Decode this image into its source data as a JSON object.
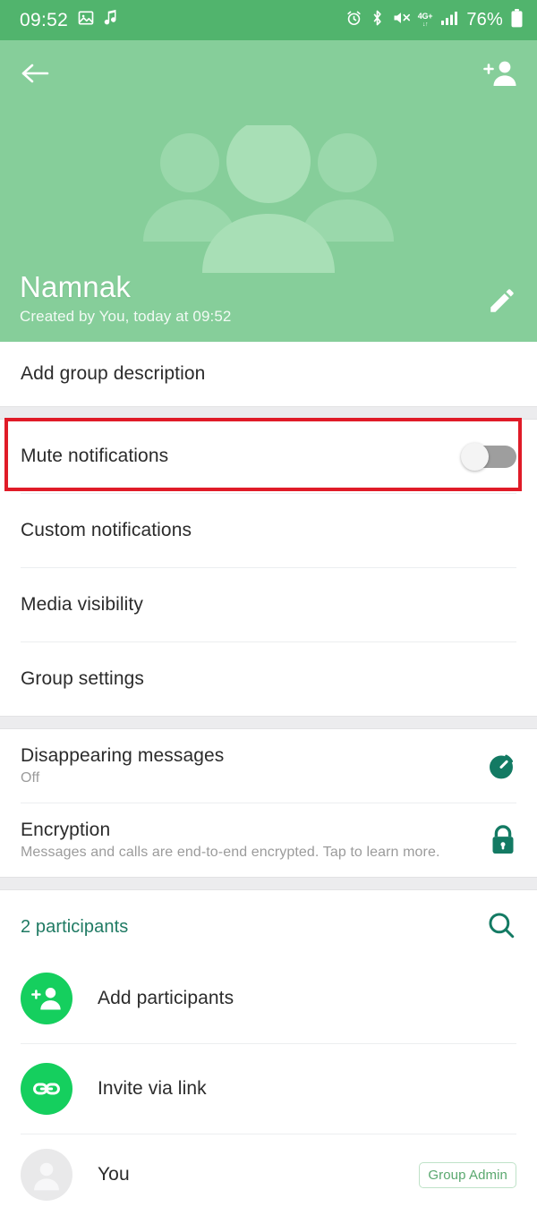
{
  "status_bar": {
    "time": "09:52",
    "battery_percent": "76%",
    "network": "4G+",
    "icons": [
      "image-icon",
      "music-note-icon",
      "alarm-icon",
      "bluetooth-icon",
      "mute-icon",
      "network-4g-icon",
      "signal-bars-icon",
      "battery-icon"
    ]
  },
  "header": {
    "back_icon": "back-arrow-icon",
    "add_member_icon": "add-person-icon",
    "group_avatar_icon": "group-people-icon",
    "group_name": "Namnak",
    "created_info": "Created by You, today at 09:52",
    "edit_icon": "pencil-icon",
    "background_color": "#86ce9a",
    "statusbar_color": "#51b46d"
  },
  "description_section": {
    "add_description_label": "Add group description"
  },
  "settings_section": {
    "items": [
      {
        "label": "Mute notifications",
        "control": "toggle",
        "toggle_on": false
      },
      {
        "label": "Custom notifications",
        "control": "none"
      },
      {
        "label": "Media visibility",
        "control": "none"
      },
      {
        "label": "Group settings",
        "control": "none",
        "highlighted": true
      }
    ]
  },
  "privacy_section": {
    "items": [
      {
        "title": "Disappearing messages",
        "subtitle": "Off",
        "icon": "timer-icon"
      },
      {
        "title": "Encryption",
        "subtitle": "Messages and calls are end-to-end encrypted. Tap to learn more.",
        "icon": "lock-icon"
      }
    ]
  },
  "participants_section": {
    "count_label": "2 participants",
    "search_icon": "search-icon",
    "rows": [
      {
        "label": "Add participants",
        "icon": "add-person-icon",
        "badge": ""
      },
      {
        "label": "Invite via link",
        "icon": "link-icon",
        "badge": ""
      },
      {
        "label": "You",
        "icon": "avatar-placeholder-icon",
        "badge": "Group Admin"
      }
    ]
  },
  "colors": {
    "accent_green": "#15cf5e",
    "teal": "#1f7a63",
    "highlight_red": "#e01b28"
  }
}
